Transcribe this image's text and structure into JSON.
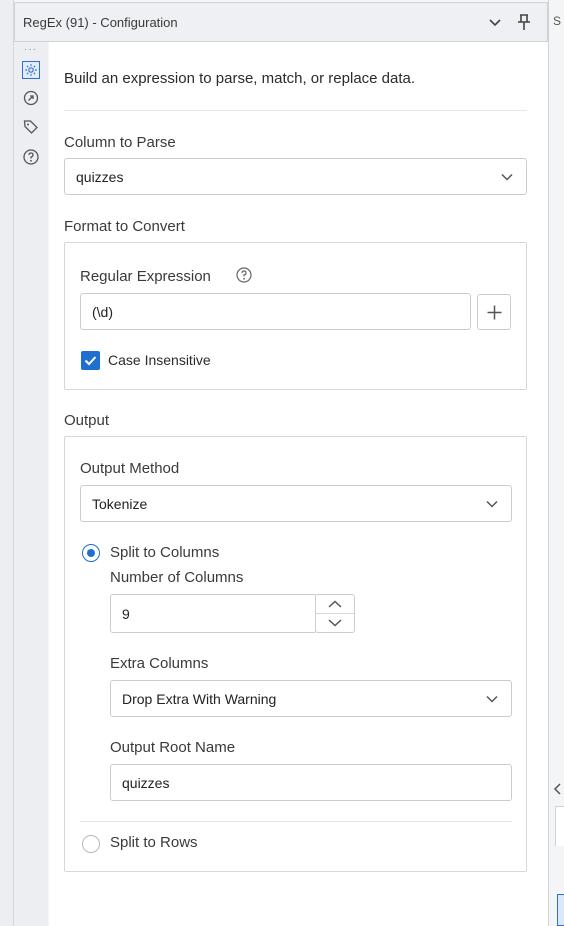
{
  "window": {
    "title": "RegEx (91) - Configuration"
  },
  "description": "Build an expression to parse, match, or replace data.",
  "column_to_parse": {
    "label": "Column to Parse",
    "value": "quizzes"
  },
  "format_to_convert": {
    "label": "Format to Convert",
    "regex_label": "Regular Expression",
    "regex_value": "(\\d)",
    "case_insensitive_label": "Case Insensitive",
    "case_insensitive_checked": true
  },
  "output": {
    "label": "Output",
    "method_label": "Output Method",
    "method_value": "Tokenize",
    "split_columns_label": "Split to Columns",
    "num_columns_label": "Number of Columns",
    "num_columns_value": "9",
    "extra_columns_label": "Extra Columns",
    "extra_columns_value": "Drop Extra With Warning",
    "root_name_label": "Output Root Name",
    "root_name_value": "quizzes",
    "split_rows_label": "Split to Rows",
    "selected_split": "columns"
  },
  "right_edge": {
    "top_text": "S"
  },
  "colors": {
    "accent": "#1f6fd1"
  }
}
